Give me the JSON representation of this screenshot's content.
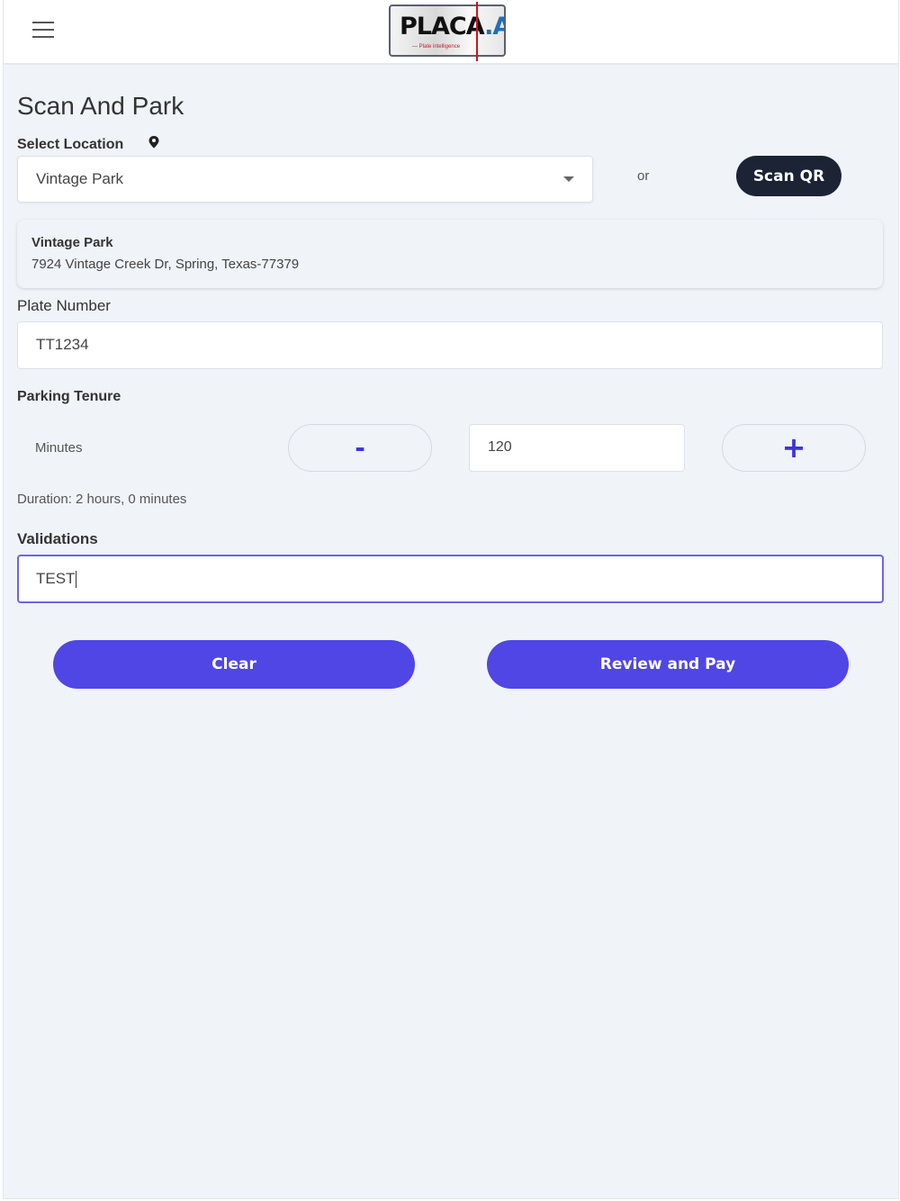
{
  "header": {
    "logo": {
      "brand": "PLACA",
      "suffix": ".AI",
      "tagline": "— Plate intelligence"
    }
  },
  "page": {
    "title": "Scan And Park"
  },
  "location": {
    "label": "Select Location",
    "selected": "Vintage Park",
    "or_text": "or",
    "scan_qr_label": "Scan QR",
    "card": {
      "name": "Vintage Park",
      "address": "7924 Vintage Creek Dr, Spring, Texas-77379"
    }
  },
  "plate": {
    "label": "Plate Number",
    "value": "TT1234"
  },
  "tenure": {
    "label": "Parking Tenure",
    "unit_label": "Minutes",
    "minus_label": "-",
    "plus_label": "+",
    "value": "120",
    "duration_text": "Duration: 2 hours, 0 minutes"
  },
  "validations": {
    "label": "Validations",
    "value": "TEST"
  },
  "actions": {
    "clear_label": "Clear",
    "pay_label": "Review and Pay"
  },
  "colors": {
    "primary": "#4f46e5",
    "dark_button": "#1b2335",
    "background": "#f0f3f8"
  }
}
